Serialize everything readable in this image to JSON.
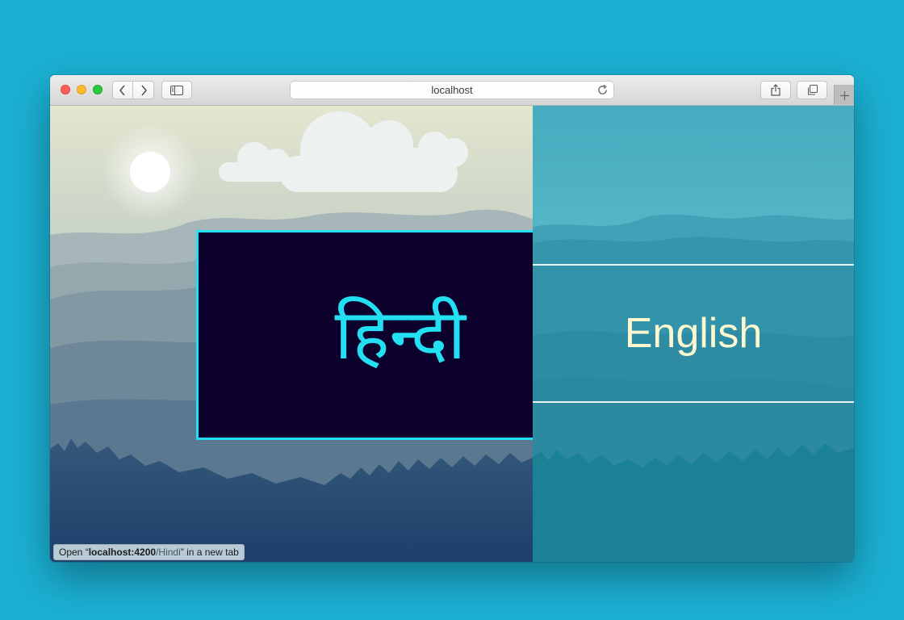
{
  "browser": {
    "address": "localhost",
    "icons": {
      "back": "chevron-left-icon",
      "forward": "chevron-right-icon",
      "sidebar": "sidebar-icon",
      "reload": "reload-icon",
      "share": "share-icon",
      "tabs": "tabs-overview-icon",
      "new_tab": "plus-icon"
    }
  },
  "page": {
    "hindi_label": "हिन्दी",
    "english_label": "English"
  },
  "status": {
    "prefix": "Open “",
    "host": "localhost:4200",
    "path": "/Hindi",
    "suffix": "” in a new tab"
  },
  "colors": {
    "desktop": "#1bb0d3",
    "hindi_panel_bg": "#0c012c",
    "accent_cyan": "#22e0f2",
    "english_text": "#fdf7cf"
  }
}
